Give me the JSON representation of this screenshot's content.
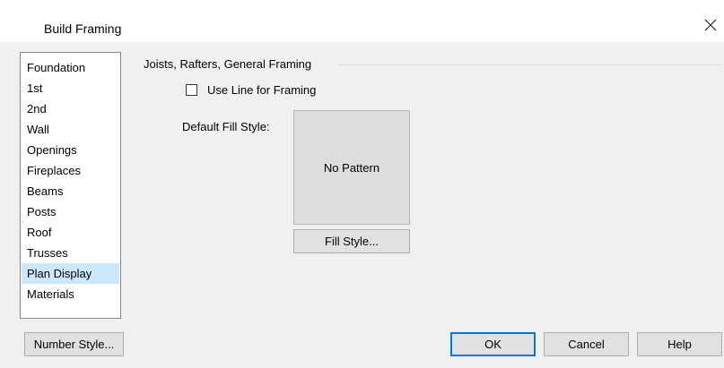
{
  "window": {
    "title": "Build Framing",
    "close_icon": "close-icon"
  },
  "categories": {
    "items": [
      {
        "label": "Foundation"
      },
      {
        "label": "1st"
      },
      {
        "label": "2nd"
      },
      {
        "label": "Wall"
      },
      {
        "label": "Openings"
      },
      {
        "label": "Fireplaces"
      },
      {
        "label": "Beams"
      },
      {
        "label": "Posts"
      },
      {
        "label": "Roof"
      },
      {
        "label": "Trusses"
      },
      {
        "label": "Plan Display"
      },
      {
        "label": "Materials"
      }
    ],
    "selected": "Plan Display"
  },
  "panel": {
    "group_title": "Joists, Rafters, General Framing",
    "use_line_label": "Use Line for Framing",
    "use_line_checked": false,
    "fill_label": "Default Fill Style:",
    "fill_preview_text": "No Pattern",
    "fill_button": "Fill Style..."
  },
  "footer": {
    "number_style": "Number Style...",
    "ok": "OK",
    "cancel": "Cancel",
    "help": "Help"
  },
  "colors": {
    "selection": "#cce8ff",
    "default_button_border": "#0078d7",
    "dialog_background": "#f0f0f0"
  }
}
